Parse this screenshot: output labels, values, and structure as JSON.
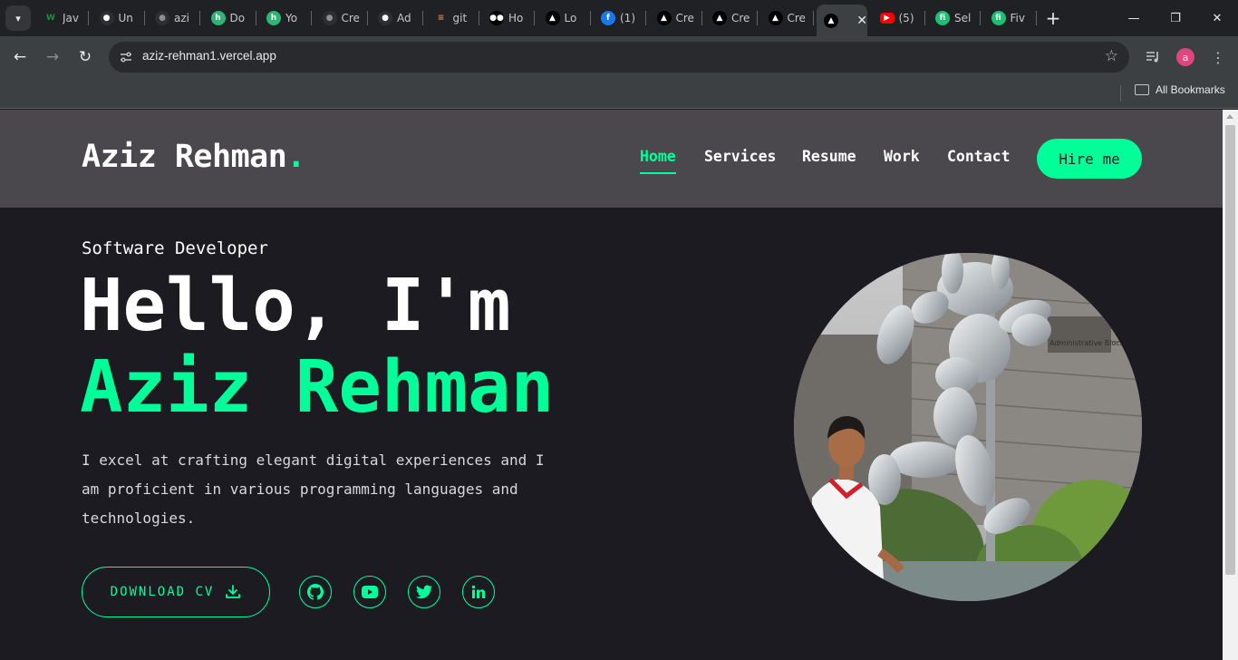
{
  "browser": {
    "tabs": [
      {
        "title": "Jav",
        "icon": "w-icon",
        "color": "#1e8e3e"
      },
      {
        "title": "Un",
        "icon": "github-icon",
        "color": "#ffffff"
      },
      {
        "title": "azi",
        "icon": "github-icon",
        "color": "#8a8d91"
      },
      {
        "title": "Do",
        "icon": "h-icon",
        "color": "#2bb673"
      },
      {
        "title": "Yo",
        "icon": "h-icon",
        "color": "#2bb673"
      },
      {
        "title": "Cre",
        "icon": "github-icon",
        "color": "#8a8d91"
      },
      {
        "title": "Ad",
        "icon": "github-icon",
        "color": "#ffffff"
      },
      {
        "title": "git",
        "icon": "stackoverflow-icon",
        "color": "#f48024"
      },
      {
        "title": "Ho",
        "icon": "medium-icon",
        "color": "#ffffff"
      },
      {
        "title": "Lo",
        "icon": "vercel-icon",
        "color": "#ffffff"
      },
      {
        "title": "(1)",
        "icon": "facebook-icon",
        "color": "#1877f2"
      },
      {
        "title": "Cre",
        "icon": "vercel-icon",
        "color": "#ffffff"
      },
      {
        "title": "Cre",
        "icon": "vercel-icon",
        "color": "#ffffff"
      },
      {
        "title": "Cre",
        "icon": "vercel-icon",
        "color": "#ffffff"
      },
      {
        "title": "",
        "icon": "vercel-icon",
        "color": "#ffffff",
        "active": true
      },
      {
        "title": "(5)",
        "icon": "youtube-icon",
        "color": "#ff0000"
      },
      {
        "title": "Sel",
        "icon": "fiverr-icon",
        "color": "#1dbf73"
      },
      {
        "title": "Fiv",
        "icon": "fiverr-icon",
        "color": "#1dbf73"
      }
    ],
    "url": "aziz-rehman1.vercel.app",
    "avatar_letter": "a",
    "bookmarks_label": "All Bookmarks"
  },
  "site": {
    "logo_text": "Aziz Rehman",
    "logo_dot": ".",
    "nav": [
      {
        "label": "Home",
        "active": true
      },
      {
        "label": "Services",
        "active": false
      },
      {
        "label": "Resume",
        "active": false
      },
      {
        "label": "Work",
        "active": false
      },
      {
        "label": "Contact",
        "active": false
      }
    ],
    "hire_label": "Hire me",
    "accent_color": "#00ff99"
  },
  "hero": {
    "role": "Software Developer",
    "greeting": "Hello, I'm",
    "name": "Aziz Rehman",
    "bio": "I excel at crafting elegant digital experiences and I am proficient in various programming languages and technologies.",
    "download_label": "DOWNLOAD CV",
    "socials": [
      "github-icon",
      "youtube-icon",
      "twitter-icon",
      "linkedin-icon"
    ]
  }
}
